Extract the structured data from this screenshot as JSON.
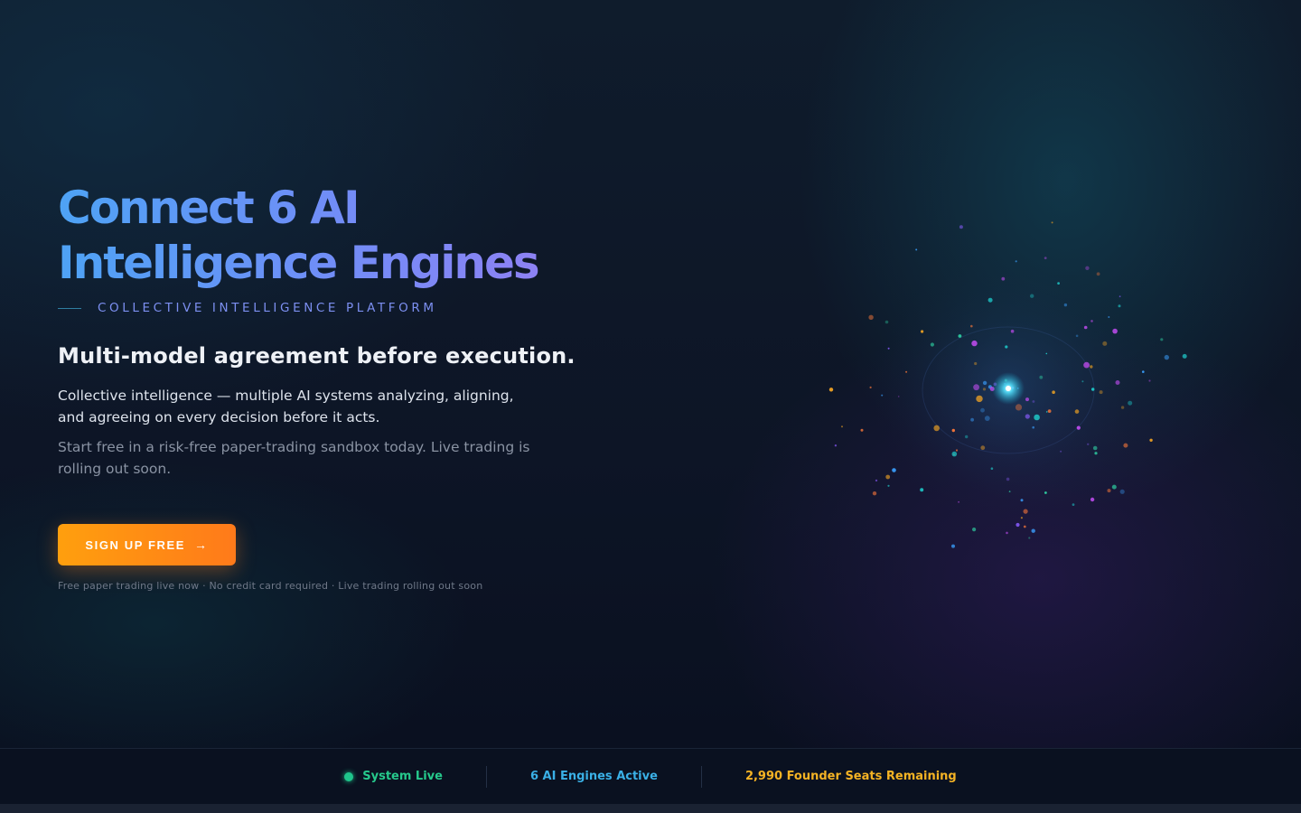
{
  "hero": {
    "title": "Connect 6 AI Intelligence Engines",
    "kicker": "COLLECTIVE INTELLIGENCE PLATFORM",
    "subhead": "Multi-model agreement before execution.",
    "paragraph1": "Collective intelligence — multiple AI systems analyzing, aligning, and agreeing on every decision before it acts.",
    "paragraph2": "Start free in a risk-free paper-trading sandbox today. Live trading is rolling out soon.",
    "cta_label": "SIGN UP FREE",
    "cta_icon": "arrow-right-icon",
    "note": "Free paper trading live now · No credit card required · Live trading rolling out soon"
  },
  "status": {
    "system": "System Live",
    "engines": "6 AI Engines Active",
    "seats": "2,990 Founder Seats Remaining"
  },
  "colors": {
    "accent_orange": "#ff8a14",
    "title_gradient_start": "#4ea3f5",
    "title_gradient_end": "#9a7cf2",
    "status_green": "#26c98c",
    "status_blue": "#3ab0e6",
    "status_amber": "#f5b324",
    "background": "#0b1220"
  }
}
